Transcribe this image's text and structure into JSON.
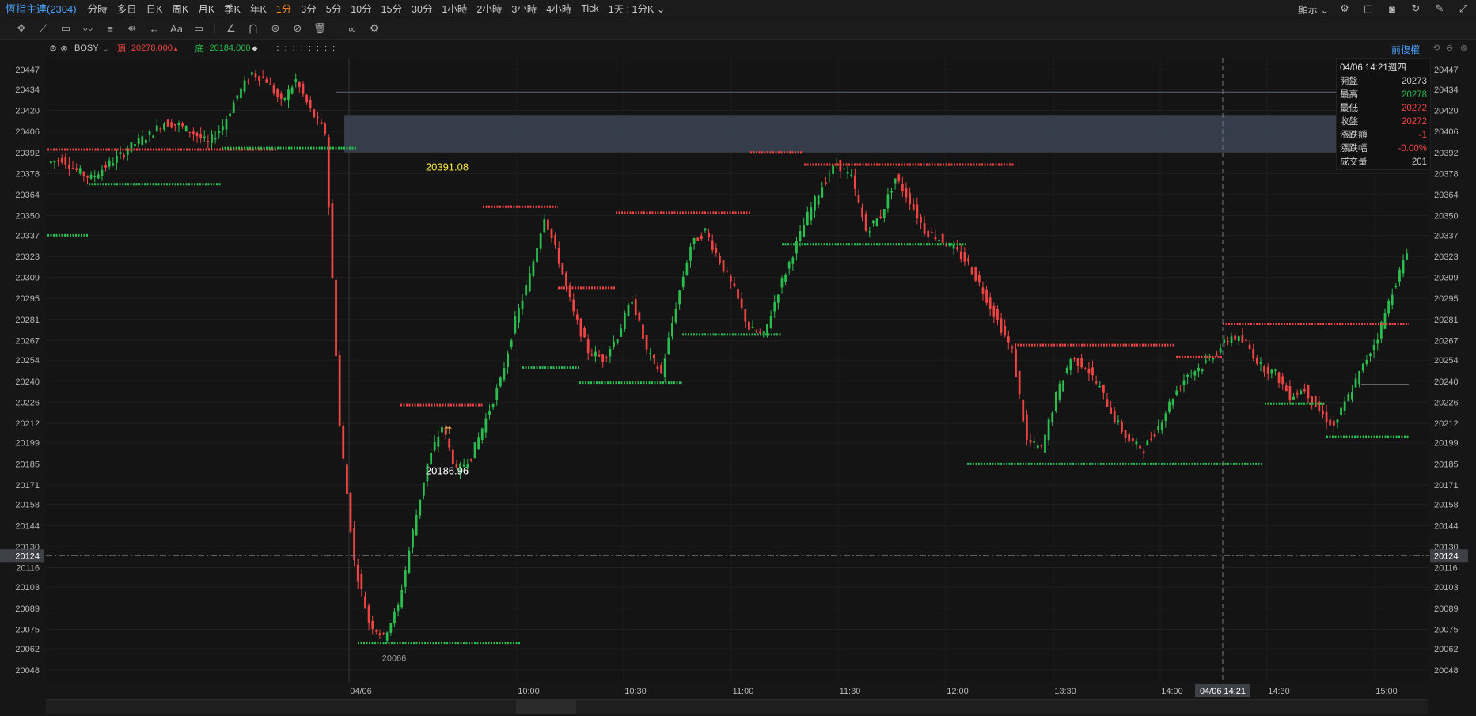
{
  "topbar": {
    "symbol": "恆指主連(2304)",
    "timeframes": [
      "分時",
      "多日",
      "日K",
      "周K",
      "月K",
      "季K",
      "年K",
      "1分",
      "3分",
      "5分",
      "10分",
      "15分",
      "30分",
      "1小時",
      "2小時",
      "3小時",
      "4小時",
      "Tick"
    ],
    "active_timeframe": "1分",
    "range_select": "1天 : 1分K",
    "display_label": "顯示"
  },
  "indicator": {
    "name": "BOSY",
    "top_label": "頂:",
    "top_value": "20278.000",
    "bottom_label": "底:",
    "bottom_value": "20184.000",
    "dots": ":    :    :    :    :    :    :    :"
  },
  "adjust_label": "前復權",
  "infobox": {
    "datetime": "04/06 14:21週四",
    "rows": [
      {
        "k": "開盤",
        "v": "20273",
        "color": "#c9c9c9"
      },
      {
        "k": "最高",
        "v": "20278",
        "color": "#2bbd4f"
      },
      {
        "k": "最低",
        "v": "20272",
        "color": "#ef4444"
      },
      {
        "k": "收盤",
        "v": "20272",
        "color": "#ef4444"
      },
      {
        "k": "漲跌額",
        "v": "-1",
        "color": "#ef4444"
      },
      {
        "k": "漲跌幅",
        "v": "-0.00%",
        "color": "#ef4444"
      },
      {
        "k": "成交量",
        "v": "201",
        "color": "#c9c9c9"
      }
    ]
  },
  "annotations": [
    {
      "text": "20391.08",
      "price": 20391.08,
      "time": "10:00",
      "color": "#f5e642"
    },
    {
      "text": "20186.96",
      "price": 20186.96,
      "time": "10:00",
      "color": "#ffffff"
    },
    {
      "text": "20066",
      "price": 20066,
      "time": "09:42",
      "color": "#9a9a9a"
    }
  ],
  "crosshair": {
    "price": "20124",
    "time": "04/06 14:21"
  },
  "chart_data": {
    "type": "candlestick",
    "y_ticks": [
      "20447",
      "20434",
      "20420",
      "20406",
      "20392",
      "20378",
      "20364",
      "20350",
      "20337",
      "20323",
      "20309",
      "20295",
      "20281",
      "20267",
      "20254",
      "20240",
      "20226",
      "20212",
      "20199",
      "20185",
      "20171",
      "20158",
      "20144",
      "20130",
      "20116",
      "20103",
      "20089",
      "20075",
      "20062",
      "20048"
    ],
    "x_ticks": [
      "04/06",
      "10:00",
      "10:30",
      "11:00",
      "11:30",
      "12:00",
      "13:30",
      "14:00",
      "14:30",
      "15:00"
    ],
    "ylim": [
      20040,
      20455
    ],
    "colors": {
      "up": "#2bbd4f",
      "down": "#ef4444"
    },
    "close_path": [
      [
        "04/05 prev",
        20385
      ],
      [
        "",
        20388
      ],
      [
        "",
        20380
      ],
      [
        "",
        20375
      ],
      [
        "",
        20383
      ],
      [
        "",
        20390
      ],
      [
        "",
        20398
      ],
      [
        "",
        20404
      ],
      [
        "",
        20412
      ],
      [
        "",
        20410
      ],
      [
        "",
        20405
      ],
      [
        "",
        20398
      ],
      [
        "",
        20410
      ],
      [
        "",
        20430
      ],
      [
        "",
        20445
      ],
      [
        "",
        20440
      ],
      [
        "",
        20425
      ],
      [
        "",
        20440
      ],
      [
        "",
        20420
      ],
      [
        "",
        20405
      ],
      [
        "04/06 09:15",
        20210
      ],
      [
        "",
        20120
      ],
      [
        "",
        20080
      ],
      [
        "",
        20070
      ],
      [
        "",
        20090
      ],
      [
        "",
        20140
      ],
      [
        "",
        20185
      ],
      [
        "",
        20210
      ],
      [
        "",
        20180
      ],
      [
        "",
        20190
      ],
      [
        "",
        20215
      ],
      [
        "",
        20240
      ],
      [
        "",
        20280
      ],
      [
        "",
        20310
      ],
      [
        "",
        20350
      ],
      [
        "",
        20320
      ],
      [
        "",
        20285
      ],
      [
        "",
        20260
      ],
      [
        "",
        20255
      ],
      [
        "",
        20270
      ],
      [
        "",
        20295
      ],
      [
        "",
        20260
      ],
      [
        "",
        20245
      ],
      [
        "",
        20290
      ],
      [
        "",
        20330
      ],
      [
        "",
        20340
      ],
      [
        "",
        20320
      ],
      [
        "",
        20300
      ],
      [
        "",
        20275
      ],
      [
        "",
        20270
      ],
      [
        "",
        20300
      ],
      [
        "",
        20325
      ],
      [
        "",
        20350
      ],
      [
        "",
        20370
      ],
      [
        "",
        20385
      ],
      [
        "",
        20375
      ],
      [
        "",
        20340
      ],
      [
        "",
        20350
      ],
      [
        "",
        20375
      ],
      [
        "",
        20360
      ],
      [
        "",
        20340
      ],
      [
        "",
        20335
      ],
      [
        "",
        20328
      ],
      [
        "",
        20318
      ],
      [
        "",
        20300
      ],
      [
        "",
        20280
      ],
      [
        "",
        20260
      ],
      [
        "",
        20200
      ],
      [
        "",
        20195
      ],
      [
        "",
        20230
      ],
      [
        "",
        20255
      ],
      [
        "",
        20250
      ],
      [
        "",
        20235
      ],
      [
        "",
        20215
      ],
      [
        "",
        20200
      ],
      [
        "",
        20195
      ],
      [
        "",
        20210
      ],
      [
        "",
        20230
      ],
      [
        "",
        20245
      ],
      [
        "",
        20250
      ],
      [
        "",
        20260
      ],
      [
        "",
        20270
      ],
      [
        "",
        20265
      ],
      [
        "",
        20250
      ],
      [
        "",
        20245
      ],
      [
        "",
        20230
      ],
      [
        "",
        20235
      ],
      [
        "",
        20220
      ],
      [
        "",
        20210
      ],
      [
        "",
        20230
      ],
      [
        "",
        20250
      ],
      [
        "",
        20270
      ],
      [
        "",
        20300
      ],
      [
        "",
        20325
      ]
    ],
    "levels": [
      {
        "type": "top",
        "price": 20394,
        "x0": "start",
        "x1": "09:10",
        "color": "#ef4444"
      },
      {
        "type": "bottom",
        "price": 20395,
        "x0": "09:05",
        "x1": "09:15",
        "color": "#2bbd4f"
      },
      {
        "type": "bottom",
        "price": 20371,
        "x0": "prev",
        "x1": "09:05",
        "color": "#2bbd4f"
      },
      {
        "type": "bottom",
        "price": 20337,
        "x0": "start",
        "x1": "prev",
        "color": "#2bbd4f"
      },
      {
        "type": "top",
        "price": 20224,
        "x0": "09:40",
        "x1": "09:55",
        "color": "#ef4444"
      },
      {
        "type": "bottom",
        "price": 20066,
        "x0": "09:20",
        "x1": "10:00",
        "color": "#2bbd4f"
      },
      {
        "type": "top",
        "price": 20356,
        "x0": "09:55",
        "x1": "10:10",
        "color": "#ef4444"
      },
      {
        "type": "bottom",
        "price": 20249,
        "x0": "10:05",
        "x1": "10:20",
        "color": "#2bbd4f"
      },
      {
        "type": "top",
        "price": 20302,
        "x0": "10:15",
        "x1": "10:30",
        "color": "#ef4444"
      },
      {
        "type": "bottom",
        "price": 20239,
        "x0": "10:20",
        "x1": "10:50",
        "color": "#2bbd4f"
      },
      {
        "type": "top",
        "price": 20352,
        "x0": "10:30",
        "x1": "11:05",
        "color": "#ef4444"
      },
      {
        "type": "bottom",
        "price": 20271,
        "x0": "10:50",
        "x1": "11:15",
        "color": "#2bbd4f"
      },
      {
        "type": "top",
        "price": 20392,
        "x0": "11:05",
        "x1": "11:20",
        "color": "#ef4444"
      },
      {
        "type": "bottom",
        "price": 20331,
        "x0": "11:15",
        "x1": "12:05",
        "color": "#2bbd4f"
      },
      {
        "type": "top",
        "price": 20384,
        "x0": "11:25",
        "x1": "12:20",
        "color": "#ef4444"
      },
      {
        "type": "bottom",
        "price": 20185,
        "x0": "12:05",
        "x1": "13:45",
        "color": "#2bbd4f"
      },
      {
        "type": "top",
        "price": 20264,
        "x0": "13:20",
        "x1": "13:55",
        "color": "#ef4444"
      },
      {
        "type": "top",
        "price": 20256,
        "x0": "14:05",
        "x1": "14:20",
        "color": "#ef4444"
      },
      {
        "type": "top",
        "price": 20278,
        "x0": "14:20",
        "x1": "15:10",
        "color": "#ef4444"
      },
      {
        "type": "bottom",
        "price": 20225,
        "x0": "14:40",
        "x1": "14:55",
        "color": "#2bbd4f"
      },
      {
        "type": "bottom",
        "price": 20203,
        "x0": "14:55",
        "x1": "15:10",
        "color": "#2bbd4f"
      }
    ]
  }
}
